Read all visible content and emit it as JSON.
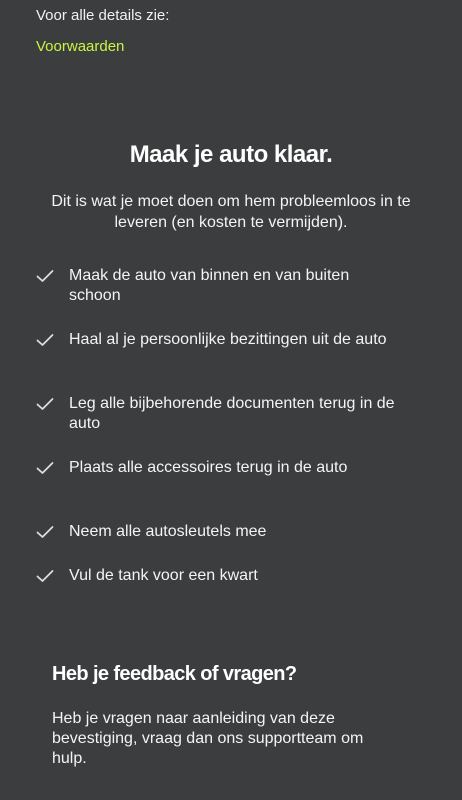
{
  "header": {
    "details_text": "Voor alle details zie:",
    "terms_link": "Voorwaarden"
  },
  "main": {
    "title": "Maak je auto klaar.",
    "subtitle": "Dit is wat je moet doen om hem probleemloos in te leveren (en kosten te vermijden).",
    "checklist": [
      {
        "icon": "checkmark-icon",
        "text": "Maak de auto van binnen en van buiten schoon"
      },
      {
        "icon": "checkmark-icon",
        "text": "Haal al je persoonlijke bezittingen uit de auto"
      },
      {
        "icon": "checkmark-icon",
        "text": "Leg alle bijbehorende documenten terug in de auto"
      },
      {
        "icon": "checkmark-icon",
        "text": "Plaats alle accessoires terug in de auto"
      },
      {
        "icon": "checkmark-icon",
        "text": "Neem alle autosleutels mee"
      },
      {
        "icon": "checkmark-icon",
        "text": "Vul de tank voor een kwart"
      }
    ]
  },
  "feedback": {
    "title": "Heb je feedback of vragen?",
    "text": "Heb je vragen naar aanleiding van deze bevestiging, vraag dan ons supportteam om hulp."
  },
  "colors": {
    "background": "#3b3d3e",
    "link": "#c8f542",
    "text": "#ffffff"
  }
}
